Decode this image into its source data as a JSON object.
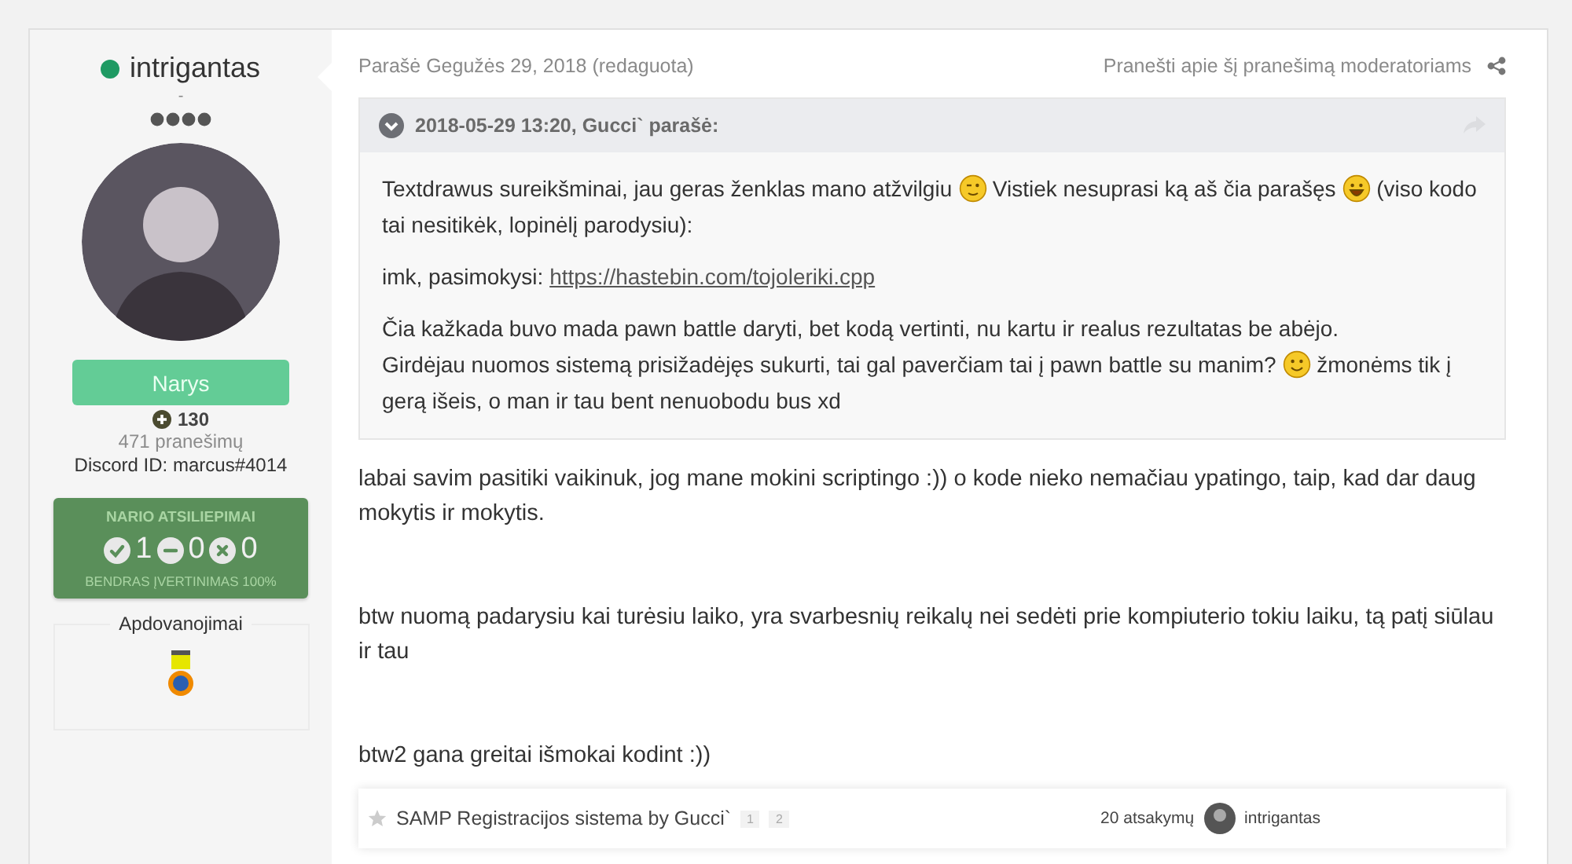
{
  "author": {
    "name": "intrigantas",
    "online": true,
    "title": "-",
    "group": "Narys",
    "reputation": "130",
    "posts": "471 pranešimų",
    "discord": "Discord ID: marcus#4014",
    "feedback": {
      "title": "NARIO ATSILIEPIMAI",
      "positive": "1",
      "neutral": "0",
      "negative": "0",
      "overall": "BENDRAS ĮVERTINIMAS 100%"
    },
    "awards_title": "Apdovanojimai"
  },
  "post": {
    "date": "Parašė Gegužės 29, 2018 (redaguota)",
    "report": "Pranešti apie šį pranešimą moderatoriams",
    "quote": {
      "header": "2018-05-29 13:20, Gucci` parašė:",
      "expanded": true,
      "paragraphs": [
        [
          {
            "kind": "text",
            "text": "Textdrawus sureikšminai, jau geras ženklas mano atžvilgiu "
          },
          {
            "kind": "wink"
          },
          {
            "kind": "text",
            "text": " Vistiek nesuprasi ką aš čia parašęs "
          },
          {
            "kind": "laugh"
          },
          {
            "kind": "text",
            "text": " (viso kodo tai nesitikėk, lopinėlį parodysiu):"
          }
        ],
        [
          {
            "kind": "text",
            "text": "imk, pasimokysi: "
          },
          {
            "kind": "link",
            "text": "https://hastebin.com/tojoleriki.cpp"
          }
        ],
        [
          {
            "kind": "text",
            "text": "Čia kažkada buvo mada pawn battle daryti, bet kodą vertinti, nu kartu ir realus rezultatas be abėjo."
          },
          {
            "kind": "break"
          },
          {
            "kind": "text",
            "text": "Girdėjau nuomos sistemą prisižadėjęs sukurti, tai gal paverčiam tai į pawn battle su manim? "
          },
          {
            "kind": "smile"
          },
          {
            "kind": "text",
            "text": " žmonėms tik į gerą išeis, o man ir tau bent nenuobodu bus xd"
          }
        ]
      ]
    },
    "paragraphs": [
      "labai savim pasitiki vaikinuk, jog mane mokini scriptingo :)) o kode nieko nemačiau ypatingo, taip, kad dar daug mokytis ir mokytis.",
      "btw nuomą padarysiu kai turėsiu laiko, yra svarbesnių reikalų nei sedėti prie kompiuterio tokiu laiku, tą patį siūlau ir tau",
      "btw2 gana greitai išmokai kodint :))"
    ]
  },
  "related": {
    "title": "SAMP Registracijos sistema by Gucci`",
    "pages": [
      "1",
      "2"
    ],
    "replies": "20 atsakymų",
    "last_poster": "intrigantas"
  }
}
